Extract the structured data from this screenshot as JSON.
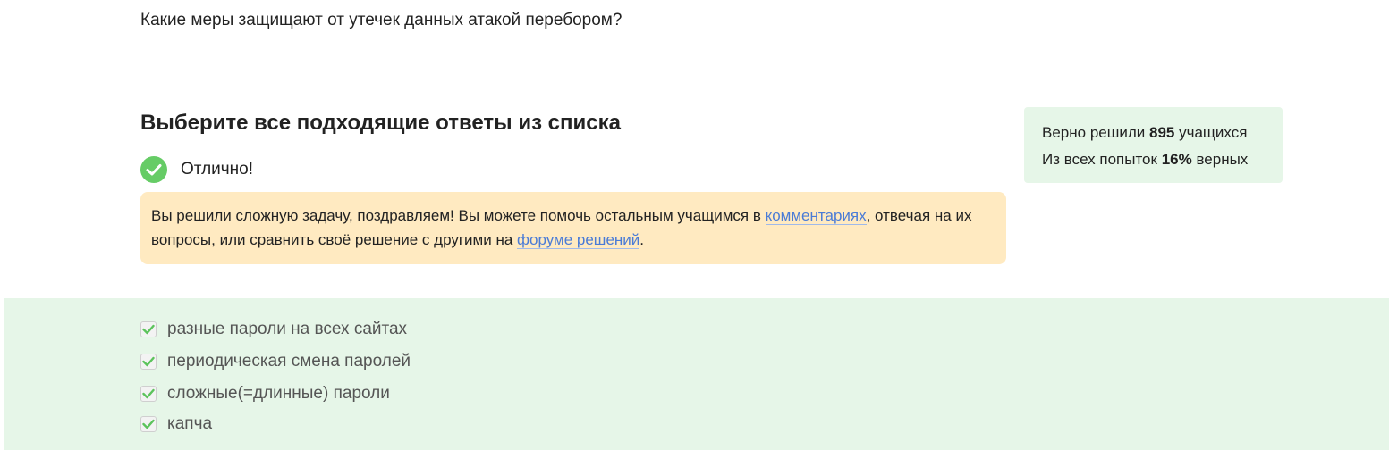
{
  "question": {
    "text": "Какие меры защищают от утечек данных атакой перебором?"
  },
  "task": {
    "title": "Выберите все подходящие ответы из списка"
  },
  "result": {
    "icon": "check-circle-icon",
    "text": "Отлично!",
    "color": "#66cc66"
  },
  "congrats": {
    "part1": "Вы решили сложную задачу, поздравляем! Вы можете помочь остальным учащимся в ",
    "link_comments": "комментариях",
    "part2": ", отвечая на их вопросы, или сравнить своё решение с другими на ",
    "link_forum": "форуме решений",
    "part3": ".",
    "background": "#ffeac1",
    "link_color": "#4a7bd6"
  },
  "stats": {
    "solved_prefix": "Верно решили ",
    "solved_count": "895",
    "solved_suffix": " учащихся",
    "attempts_prefix": "Из всех попыток ",
    "attempts_percent": "16%",
    "attempts_suffix": " верных",
    "background": "#e6f6e8"
  },
  "options": [
    {
      "label": "разные пароли на всех сайтах",
      "checked": true
    },
    {
      "label": "периодическая смена паролей",
      "checked": true
    },
    {
      "label": "сложные(=длинные) пароли",
      "checked": true
    },
    {
      "label": "капча",
      "checked": true
    }
  ]
}
